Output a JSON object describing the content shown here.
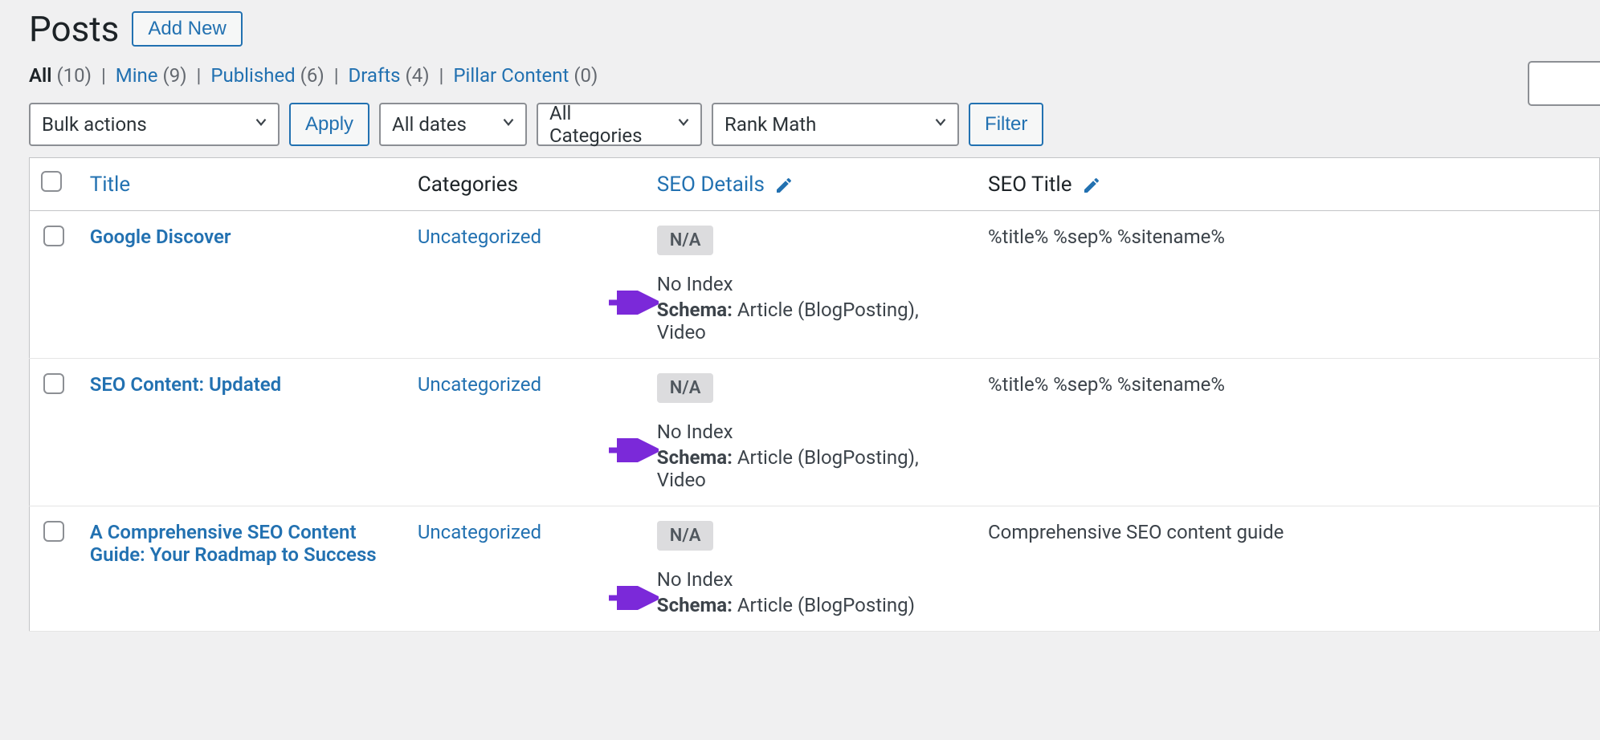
{
  "header": {
    "title": "Posts",
    "add_new": "Add New"
  },
  "filters": {
    "all": {
      "label": "All",
      "count": "(10)"
    },
    "mine": {
      "label": "Mine",
      "count": "(9)"
    },
    "published": {
      "label": "Published",
      "count": "(6)"
    },
    "drafts": {
      "label": "Drafts",
      "count": "(4)"
    },
    "pillar": {
      "label": "Pillar Content",
      "count": "(0)"
    },
    "sep": "|"
  },
  "controls": {
    "bulk_actions": "Bulk actions",
    "apply": "Apply",
    "all_dates": "All dates",
    "all_categories": "All Categories",
    "rank_math": "Rank Math",
    "filter": "Filter"
  },
  "columns": {
    "title": "Title",
    "categories": "Categories",
    "seo_details": "SEO Details",
    "seo_title": "SEO Title"
  },
  "rows": [
    {
      "title": "Google Discover",
      "category": "Uncategorized",
      "badge": "N/A",
      "index_status": "No Index",
      "schema_label": "Schema:",
      "schema_value": "Article (BlogPosting), Video",
      "seo_title": "%title% %sep% %sitename%"
    },
    {
      "title": "SEO Content: Updated",
      "category": "Uncategorized",
      "badge": "N/A",
      "index_status": "No Index",
      "schema_label": "Schema:",
      "schema_value": "Article (BlogPosting), Video",
      "seo_title": "%title% %sep% %sitename%"
    },
    {
      "title": "A Comprehensive SEO Content Guide: Your Roadmap to Success",
      "category": "Uncategorized",
      "badge": "N/A",
      "index_status": "No Index",
      "schema_label": "Schema:",
      "schema_value": "Article (BlogPosting)",
      "seo_title": "Comprehensive SEO content guide"
    }
  ],
  "colors": {
    "link": "#2271b1",
    "annotation": "#8a2be2"
  }
}
